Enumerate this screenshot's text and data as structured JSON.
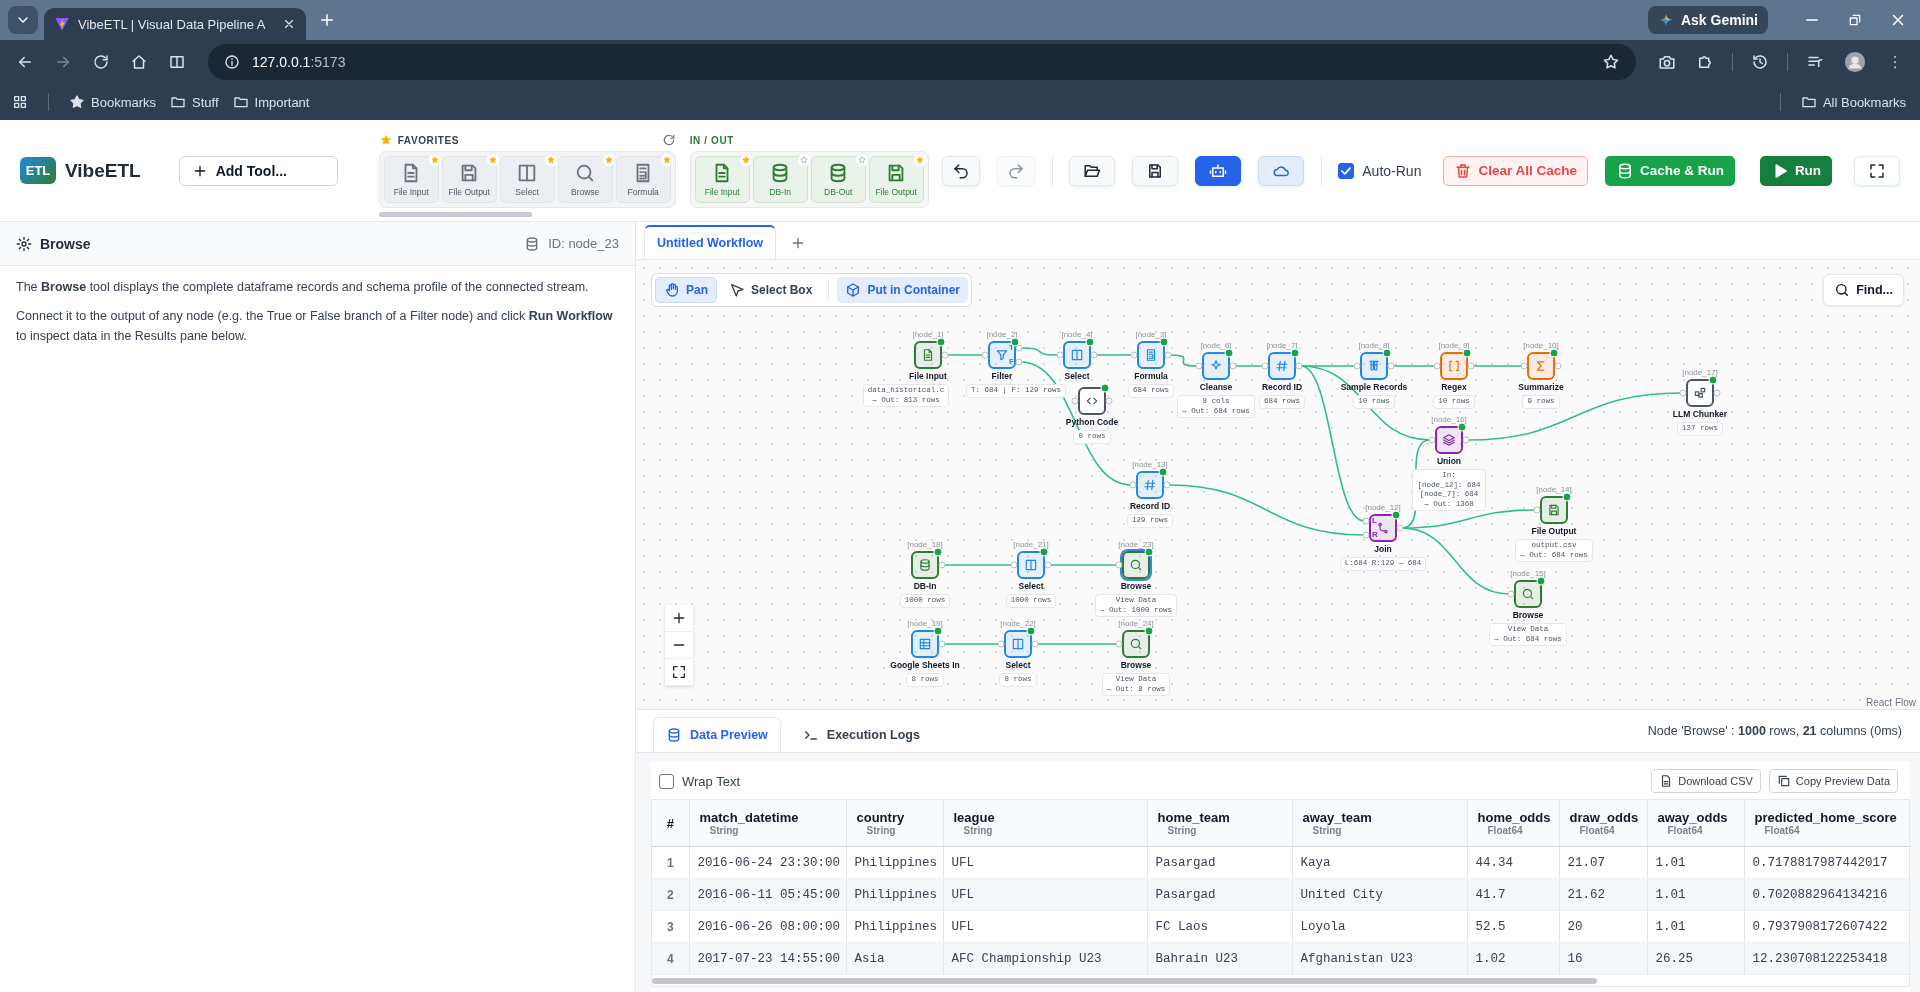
{
  "browser": {
    "tab_title": "VibeETL | Visual Data Pipeline A",
    "url_host": "127.0.0.1",
    "url_port": ":5173",
    "ask_button": "Ask Gemini",
    "bookmarks": [
      {
        "label": "Bookmarks",
        "kind": "star"
      },
      {
        "label": "Stuff",
        "kind": "folder"
      },
      {
        "label": "Important",
        "kind": "folder"
      }
    ],
    "all_bookmarks": "All Bookmarks"
  },
  "header": {
    "logo_badge": "ETL",
    "app_name": "VibeETL",
    "add_tool": "Add Tool...",
    "palette": [
      {
        "title": "FAVORITES",
        "kind": "favorites",
        "tools": [
          {
            "label": "File Input",
            "favorite": true
          },
          {
            "label": "File Output",
            "favorite": true
          },
          {
            "label": "Select",
            "favorite": true
          },
          {
            "label": "Browse",
            "favorite": true
          },
          {
            "label": "Formula",
            "favorite": true
          }
        ]
      },
      {
        "title": "IN / OUT",
        "kind": "io",
        "tools": [
          {
            "label": "File Input",
            "favorite": true
          },
          {
            "label": "DB-In",
            "favorite": false
          },
          {
            "label": "DB-Out",
            "favorite": false
          },
          {
            "label": "File Output",
            "favorite": true
          }
        ]
      }
    ],
    "toolbar": [
      {
        "kind": "undo",
        "disabled": false
      },
      {
        "kind": "redo",
        "disabled": true
      },
      {
        "kind": "open",
        "disabled": false
      },
      {
        "kind": "save",
        "disabled": false
      },
      {
        "kind": "assistant",
        "disabled": false
      },
      {
        "kind": "cloud",
        "disabled": false
      }
    ],
    "auto_run": {
      "label": "Auto-Run",
      "checked": true
    },
    "actions": [
      {
        "label": "Clear All Cache",
        "kind": "clear"
      },
      {
        "label": "Cache & Run",
        "kind": "cache_run"
      },
      {
        "label": "Run",
        "kind": "run"
      }
    ]
  },
  "inspector": {
    "title": "Browse",
    "node_id": "ID: node_23",
    "paragraphs": [
      "The **Browse** tool displays the complete dataframe records and schema profile of the connected stream.",
      "Connect it to the output of any node (e.g. the True or False branch of a Filter node) and click **Run Workflow** to inspect data in the Results pane below."
    ]
  },
  "workflow_tabs": [
    {
      "label": "Untitled Workflow",
      "selected": true
    }
  ],
  "canvas": {
    "tools": [
      {
        "label": "Pan",
        "kind": "mode",
        "selected": true
      },
      {
        "label": "Select Box",
        "kind": "mode",
        "selected": false
      },
      {
        "label": "Put in Container",
        "kind": "action",
        "selected": false
      }
    ],
    "find": "Find...",
    "attribution": "React Flow",
    "nodes": [
      {
        "id_tag": "[node_1]",
        "label": "File Input",
        "kind": "file",
        "color": "#2e7d32",
        "stats": [
          "data_historical.c",
          "→ Out: 813 rows"
        ],
        "selected": false
      },
      {
        "id_tag": "[node_2]",
        "label": "Filter",
        "kind": "filter",
        "color": "#1e88e5",
        "ports": [
          "T",
          "F"
        ],
        "stats": [
          "T: 684 | F: 129 rows"
        ],
        "selected": false
      },
      {
        "id_tag": "[node_4]",
        "label": "Select",
        "kind": "select",
        "color": "#1e88e5",
        "selected": false
      },
      {
        "id_tag": "[node_3]",
        "label": "Formula",
        "kind": "formula",
        "color": "#1e88e5",
        "stats": [
          "684 rows"
        ],
        "selected": false
      },
      {
        "id_tag": "[node_6]",
        "label": "Cleanse",
        "kind": "cleanse",
        "color": "#1e88e5",
        "stats": [
          "8 cols",
          "→ Out: 684 rows"
        ],
        "selected": false
      },
      {
        "id_tag": "[node_7]",
        "label": "Record ID",
        "kind": "hash",
        "color": "#1e88e5",
        "stats": [
          "684 rows"
        ],
        "selected": false
      },
      {
        "id_tag": "[node_8]",
        "label": "Sample Records",
        "kind": "sample",
        "color": "#1e88e5",
        "stats": [
          "10 rows"
        ],
        "selected": false
      },
      {
        "id_tag": "[node_9]",
        "label": "Regex",
        "kind": "regex",
        "color": "#ef6c00",
        "stats": [
          "10 rows"
        ],
        "selected": false
      },
      {
        "id_tag": "[node_10]",
        "label": "Summarize",
        "kind": "summarize",
        "color": "#ef6c00",
        "stats": [
          "9 rows"
        ],
        "selected": false
      },
      {
        "label": "Python Code",
        "kind": "code",
        "color": "#4b5563",
        "stats": [
          "0 rows"
        ],
        "selected": false
      },
      {
        "id_tag": "[node_17]",
        "label": "LLM Chunker",
        "kind": "chunker",
        "color": "#4b5563",
        "stats": [
          "137 rows"
        ],
        "selected": false
      },
      {
        "id_tag": "[node_13]",
        "label": "Record ID",
        "kind": "hash",
        "color": "#1e88e5",
        "stats": [
          "129 rows"
        ],
        "selected": false
      },
      {
        "id_tag": "[node_12]",
        "label": "Join",
        "kind": "join",
        "color": "#8e24aa",
        "ports": [
          "L",
          "R"
        ],
        "stats": [
          "L:684 R:129 → 684"
        ],
        "selected": false
      },
      {
        "id_tag": "[node_16]",
        "label": "Union",
        "kind": "union",
        "color": "#8e24aa",
        "stats": [
          "In:",
          "[node_12]: 684",
          "[node_7]: 684",
          "→ Out: 1368"
        ],
        "selected": false
      },
      {
        "id_tag": "[node_14]",
        "label": "File Output",
        "kind": "save",
        "color": "#2e7d32",
        "stats": [
          "output.csv",
          "→ Out: 684 rows"
        ],
        "selected": false
      },
      {
        "id_tag": "[node_18]",
        "label": "DB-In",
        "kind": "db",
        "color": "#2e7d32",
        "stats": [
          "1000 rows"
        ],
        "selected": false
      },
      {
        "id_tag": "[node_21]",
        "label": "Select",
        "kind": "select",
        "color": "#1e88e5",
        "stats": [
          "1000 rows"
        ],
        "selected": false
      },
      {
        "id_tag": "[node_23]",
        "label": "Browse",
        "kind": "browse",
        "color": "#2e7d32",
        "stats": [
          "View Data",
          "→ Out: 1000 rows"
        ],
        "selected": true
      },
      {
        "id_tag": "[node_15]",
        "label": "Browse",
        "kind": "browse",
        "color": "#2e7d32",
        "stats": [
          "View Data",
          "→ Out: 684 rows"
        ],
        "selected": false
      },
      {
        "id_tag": "[node_19]",
        "label": "Google Sheets In",
        "kind": "sheets",
        "color": "#1e88e5",
        "stats": [
          "8 rows"
        ],
        "selected": false
      },
      {
        "id_tag": "[node_22]",
        "label": "Select",
        "kind": "select",
        "color": "#1e88e5",
        "stats": [
          "8 rows"
        ],
        "selected": false
      },
      {
        "id_tag": "[node_24]",
        "label": "Browse",
        "kind": "browse",
        "color": "#2e7d32",
        "stats": [
          "View Data",
          "→ Out: 8 rows"
        ],
        "selected": false
      }
    ]
  },
  "results": {
    "tabs": [
      {
        "label": "Data Preview",
        "selected": true
      },
      {
        "label": "Execution Logs",
        "selected": false
      }
    ],
    "summary": "Node 'Browse' : **1000** rows, **21** columns (0ms)",
    "wrap_text": {
      "label": "Wrap Text",
      "checked": false
    },
    "buttons": [
      {
        "label": "Download CSV"
      },
      {
        "label": "Copy Preview Data"
      }
    ],
    "table": {
      "columns": [
        {
          "name": "#"
        },
        {
          "name": "match_datetime",
          "type": "String"
        },
        {
          "name": "country",
          "type": "String"
        },
        {
          "name": "league",
          "type": "String"
        },
        {
          "name": "home_team",
          "type": "String"
        },
        {
          "name": "away_team",
          "type": "String"
        },
        {
          "name": "home_odds",
          "type": "Float64"
        },
        {
          "name": "draw_odds",
          "type": "Float64"
        },
        {
          "name": "away_odds",
          "type": "Float64"
        },
        {
          "name": "predicted_home_score",
          "type": "Float64"
        }
      ],
      "rows": [
        [
          "1",
          "2016-06-24 23:30:00",
          "Philippines",
          "UFL",
          "Pasargad",
          "Kaya",
          "44.34",
          "21.07",
          "1.01",
          "0.7178817987442017"
        ],
        [
          "2",
          "2016-06-11 05:45:00",
          "Philippines",
          "UFL",
          "Pasargad",
          "United City",
          "41.7",
          "21.62",
          "1.01",
          "0.7020882964134216"
        ],
        [
          "3",
          "2016-06-26 08:00:00",
          "Philippines",
          "UFL",
          "FC Laos",
          "Loyola",
          "52.5",
          "20",
          "1.01",
          "0.7937908172607422"
        ],
        [
          "4",
          "2017-07-23 14:55:00",
          "Asia",
          "AFC Championship U23",
          "Bahrain U23",
          "Afghanistan U23",
          "1.02",
          "16",
          "26.25",
          "12.230708122253418"
        ]
      ]
    }
  }
}
